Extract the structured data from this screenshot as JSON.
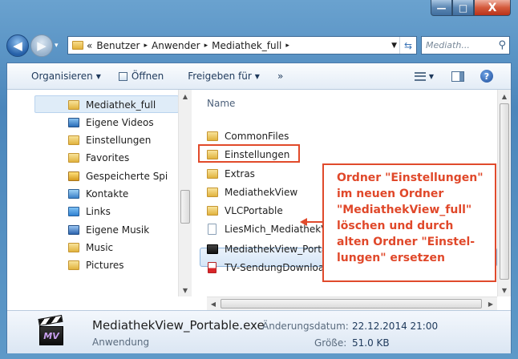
{
  "window": {
    "minimize_symbol": "—",
    "maximize_symbol": "□",
    "close_symbol": "X"
  },
  "navigation": {
    "back_symbol": "◀",
    "forward_symbol": "▶",
    "history_symbol": "▾"
  },
  "address": {
    "prefix": "«",
    "crumbs": [
      "Benutzer",
      "Anwender",
      "Mediathek_full"
    ],
    "separator": "▸"
  },
  "search": {
    "placeholder": "Mediath..."
  },
  "toolbar": {
    "organize": "Organisieren",
    "open": "Öffnen",
    "share": "Freigeben für",
    "more": "»"
  },
  "nav_pane": {
    "items": [
      {
        "label": "Mediathek_full",
        "icon": "folder"
      },
      {
        "label": "Eigene Videos",
        "icon": "video"
      },
      {
        "label": "Einstellungen",
        "icon": "folder"
      },
      {
        "label": "Favorites",
        "icon": "folder"
      },
      {
        "label": "Gespeicherte Spi",
        "icon": "saved-games"
      },
      {
        "label": "Kontakte",
        "icon": "contacts"
      },
      {
        "label": "Links",
        "icon": "links"
      },
      {
        "label": "Eigene Musik",
        "icon": "music"
      },
      {
        "label": "Music",
        "icon": "folder"
      },
      {
        "label": "Pictures",
        "icon": "folder"
      }
    ]
  },
  "file_list": {
    "column_name": "Name",
    "items": [
      {
        "label": "CommonFiles",
        "icon": "folder"
      },
      {
        "label": "Einstellungen",
        "icon": "folder"
      },
      {
        "label": "Extras",
        "icon": "folder"
      },
      {
        "label": "MediathekView",
        "icon": "folder"
      },
      {
        "label": "VLCPortable",
        "icon": "folder"
      },
      {
        "label": "LiesMich_MediathekView.txt",
        "icon": "text-file"
      },
      {
        "label": "MediathekView_Portable.exe",
        "icon": "exe"
      },
      {
        "label": "TV-SendungDownload_MediathekView.pdf",
        "icon": "pdf"
      }
    ],
    "selected_item": "MediathekView_Portable.exe"
  },
  "annotation": {
    "lines": [
      "Ordner \"Einstellungen\"",
      "im neuen Ordner",
      "\"MediathekView_full\"",
      "löschen und durch",
      "alten Ordner \"Einstel-",
      "lungen\" ersetzen"
    ],
    "color": "#e04a2c"
  },
  "details": {
    "filename": "MediathekView_Portable.exe",
    "type": "Anwendung",
    "modified_label": "Änderungsdatum:",
    "modified_value": "22.12.2014 21:00",
    "size_label": "Größe:",
    "size_value": "51.0 KB",
    "icon_text": "MV"
  },
  "colors": {
    "title_bar": "#4b86bb",
    "close_button": "#d45a3c",
    "selection": "#d6e6f7"
  }
}
